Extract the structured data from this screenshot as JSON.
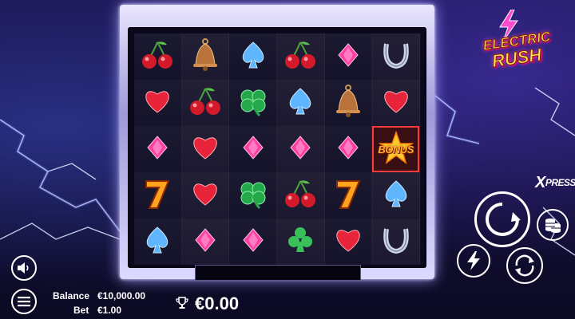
{
  "game": {
    "title_line1": "ELECTRIC",
    "title_line2": "RUSH"
  },
  "reels": {
    "rows": [
      [
        "cherries-icon",
        "bell-icon",
        "spade-icon",
        "cherries-icon",
        "diamond-icon",
        "horseshoe-icon"
      ],
      [
        "heart-icon",
        "cherries-icon",
        "clover-icon",
        "spade-icon",
        "bell-icon",
        "heart-icon"
      ],
      [
        "diamond-icon",
        "heart-icon",
        "diamond-icon",
        "diamond-icon",
        "diamond-icon",
        "bonus-star-icon"
      ],
      [
        "seven-icon",
        "heart-icon",
        "clover-icon",
        "cherries-icon",
        "seven-icon",
        "spade-icon"
      ],
      [
        "spade-icon",
        "diamond-icon",
        "diamond-icon",
        "club-icon",
        "heart-icon",
        "horseshoe-icon"
      ]
    ],
    "bonus_label": "BONUS"
  },
  "controls": {
    "xpress_x": "X",
    "xpress_label": "PRESS"
  },
  "footer": {
    "balance_label": "Balance",
    "balance_value": "€10,000.00",
    "bet_label": "Bet",
    "bet_value": "€1.00",
    "win_value": "€0.00"
  },
  "colors": {
    "accent": "#ffe45a",
    "frame": "#dcd9ff",
    "bonus_border": "#ff3a3a"
  }
}
